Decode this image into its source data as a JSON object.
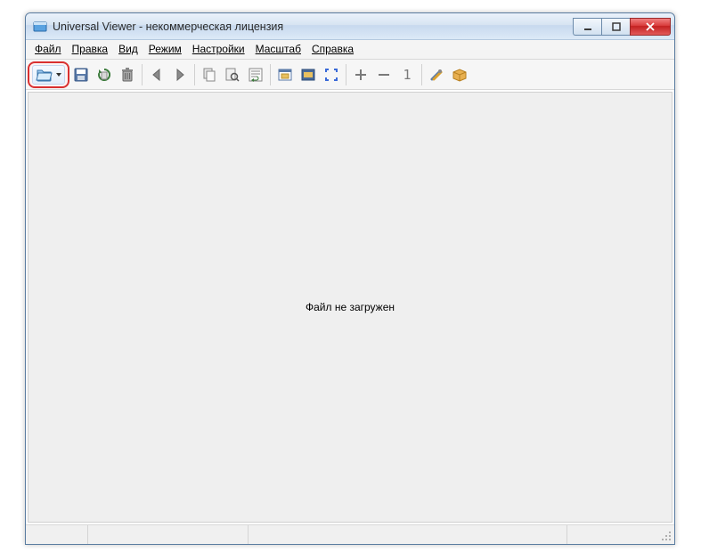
{
  "title": "Universal Viewer - некоммерческая лицензия",
  "menu": {
    "file": "Файл",
    "edit": "Правка",
    "view": "Вид",
    "mode": "Режим",
    "settings": "Настройки",
    "zoom": "Масштаб",
    "help": "Справка"
  },
  "toolbar": {
    "open": "open",
    "save": "save",
    "reload": "reload",
    "delete": "delete",
    "back": "back",
    "forward": "forward",
    "copy": "copy",
    "search": "search",
    "wrap": "wrap",
    "fit_window": "fit-window",
    "fit_width": "fit-width",
    "fullscreen": "fullscreen",
    "zoom_in": "zoom-in",
    "zoom_out": "zoom-out",
    "zoom_100": "zoom-100",
    "options": "options",
    "plugins": "plugins"
  },
  "content": {
    "empty_message": "Файл не загружен"
  }
}
